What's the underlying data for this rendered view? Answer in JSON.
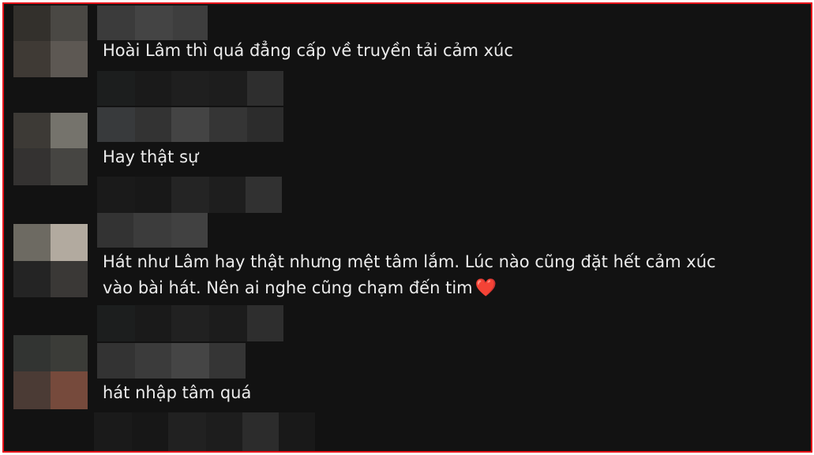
{
  "colors": {
    "frame_border": "#e8141b",
    "background": "#121212",
    "text": "#ececec",
    "heart": "#e0243a"
  },
  "comments": [
    {
      "text": "Hoài Lâm thì quá đẳng cấp về truyền tải cảm xúc"
    },
    {
      "text": "Hay thật sự"
    },
    {
      "text_line1": "Hát như Lâm hay thật nhưng mệt tâm lắm. Lúc nào cũng đặt hết cảm xúc",
      "text_line2": "vào bài hát. Nên ai nghe cũng chạm đến tim",
      "emoji": "❤️"
    },
    {
      "text": "hát nhập tâm quá"
    }
  ]
}
